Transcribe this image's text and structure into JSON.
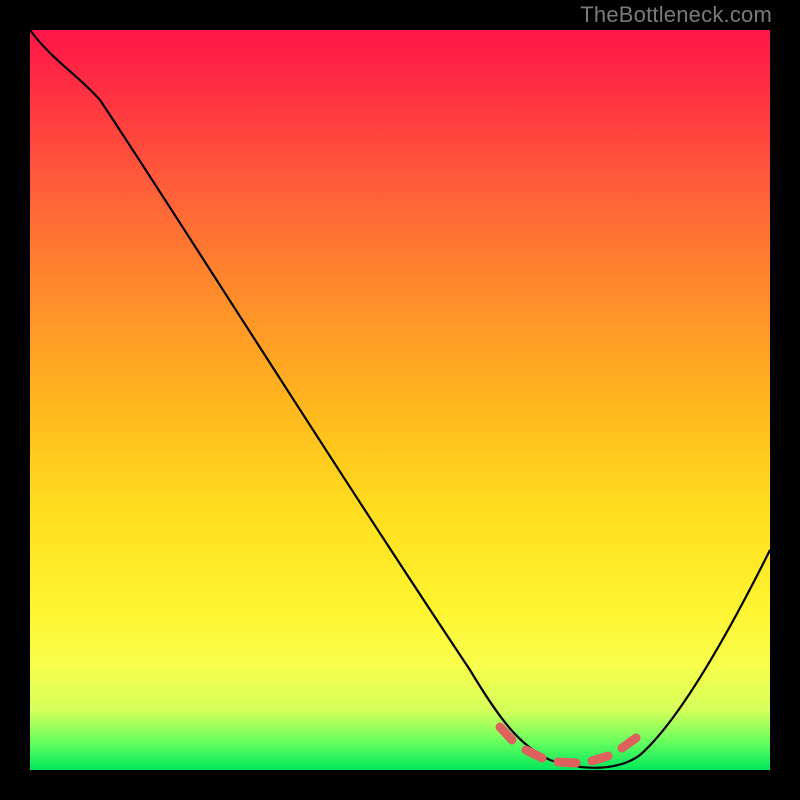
{
  "watermark": "TheBottleneck.com",
  "chart_data": {
    "type": "line",
    "title": "",
    "xlabel": "",
    "ylabel": "",
    "xlim": [
      0,
      100
    ],
    "ylim": [
      0,
      100
    ],
    "grid": false,
    "legend": false,
    "series": [
      {
        "name": "bottleneck-curve",
        "x": [
          0,
          5,
          10,
          18,
          28,
          40,
          52,
          60,
          65,
          70,
          75,
          80,
          85,
          90,
          100
        ],
        "values": [
          100,
          97,
          93,
          84,
          71,
          55,
          39,
          27,
          15,
          4,
          0,
          0,
          4,
          13,
          32
        ]
      }
    ],
    "annotations": [
      {
        "name": "optimal-range",
        "type": "range-marker",
        "x_start": 65,
        "x_end": 83,
        "color": "#de615e"
      }
    ]
  }
}
